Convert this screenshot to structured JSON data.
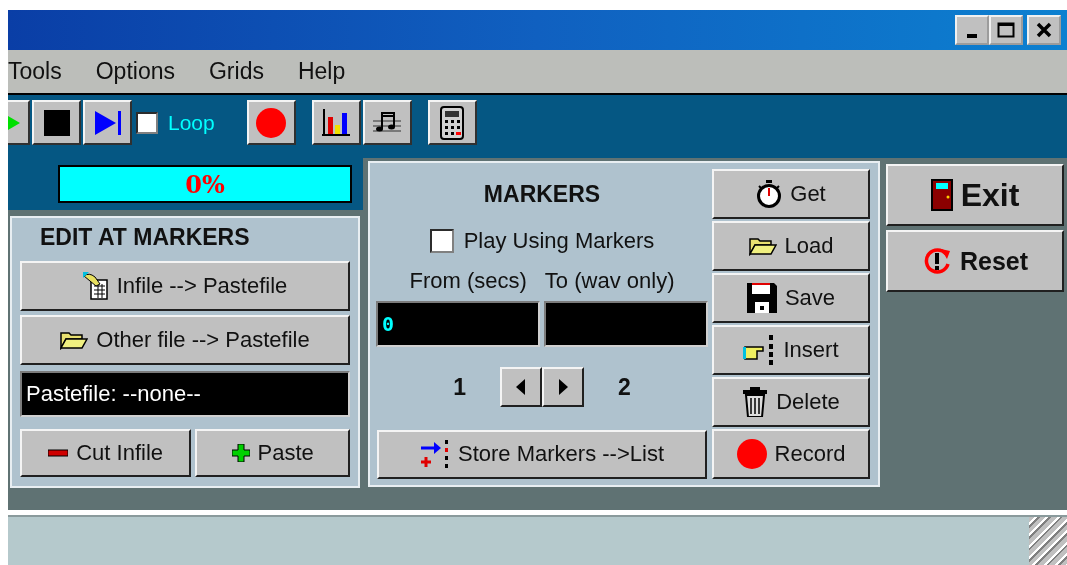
{
  "window": {
    "controls": [
      {
        "kind": "minimize"
      },
      {
        "kind": "maximize"
      },
      {
        "kind": "close"
      }
    ]
  },
  "menu": [
    {
      "label": "Tools"
    },
    {
      "label": "Options"
    },
    {
      "label": "Grids"
    },
    {
      "label": "Help"
    }
  ],
  "toolbar": {
    "buttons": [
      {
        "kind": "play"
      },
      {
        "kind": "stop"
      },
      {
        "kind": "next"
      }
    ],
    "loop": {
      "label": "Loop",
      "checked": false
    },
    "tools": [
      {
        "kind": "record"
      },
      {
        "kind": "chart"
      },
      {
        "kind": "music"
      },
      {
        "kind": "calculator"
      }
    ]
  },
  "progress": {
    "text": "0%"
  },
  "edit_at_markers": {
    "title": "EDIT AT MARKERS",
    "buttons": [
      {
        "label": "Infile --> Pastefile",
        "kind": "infile"
      },
      {
        "label": "Other file --> Pastefile",
        "kind": "folder"
      }
    ],
    "pastefile": "Pastefile: --none--",
    "actions": [
      {
        "label": "Cut Infile",
        "kind": "minus"
      },
      {
        "label": "Paste",
        "kind": "plus"
      }
    ]
  },
  "markers": {
    "title": "MARKERS",
    "play_using_markers": {
      "label": "Play Using Markers",
      "checked": false
    },
    "from_label": "From (secs)",
    "to_label": "To (wav only)",
    "from_value": "0",
    "marker_from": "1",
    "marker_to": "2",
    "store_button": "Store Markers -->List",
    "buttons": [
      {
        "label": "Get",
        "kind": "stopwatch"
      },
      {
        "label": "Load",
        "kind": "folder"
      },
      {
        "label": "Save",
        "kind": "disk"
      },
      {
        "label": "Insert",
        "kind": "insert"
      },
      {
        "label": "Delete",
        "kind": "trash"
      },
      {
        "label": "Record",
        "kind": "record"
      }
    ]
  },
  "side_buttons": [
    {
      "label": "Exit",
      "kind": "door"
    },
    {
      "label": "Reset",
      "kind": "reset"
    }
  ]
}
